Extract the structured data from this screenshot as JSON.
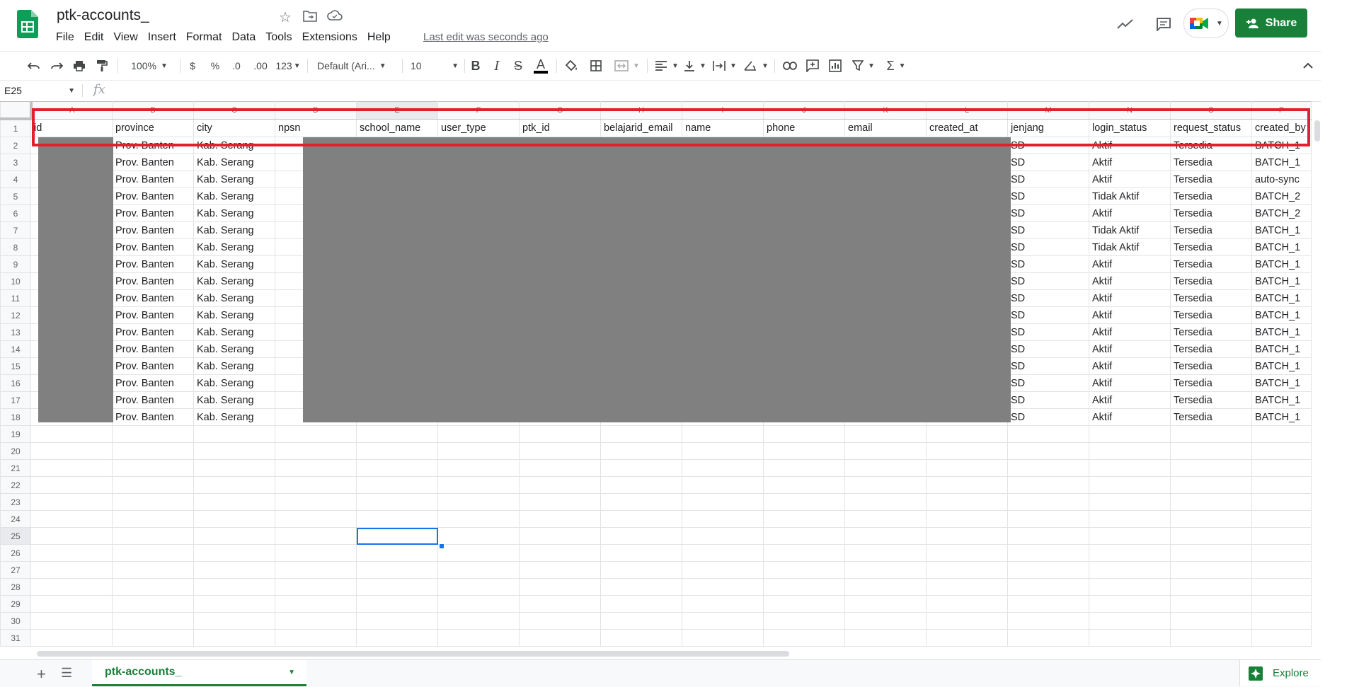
{
  "doc": {
    "title": "ptk-accounts_",
    "last_edit": "Last edit was seconds ago"
  },
  "menu": [
    "File",
    "Edit",
    "View",
    "Insert",
    "Format",
    "Data",
    "Tools",
    "Extensions",
    "Help"
  ],
  "header": {
    "share_label": "Share"
  },
  "toolbar": {
    "zoom": "100%",
    "currency": "$",
    "percent": "%",
    "dec_decrease": ".0",
    "dec_increase": ".00",
    "more_formats": "123",
    "font": "Default (Ari...",
    "font_size": "10",
    "bold": "B",
    "italic": "I",
    "strike": "S",
    "text_color": "A"
  },
  "formula_bar": {
    "name_box": "E25",
    "fx": "fx"
  },
  "columns": [
    "A",
    "B",
    "C",
    "D",
    "E",
    "F",
    "G",
    "H",
    "I",
    "J",
    "K",
    "L",
    "M",
    "N",
    "O",
    "P"
  ],
  "header_row": [
    "id",
    "province",
    "city",
    "npsn",
    "school_name",
    "user_type",
    "ptk_id",
    "belajarid_email",
    "name",
    "phone",
    "email",
    "created_at",
    "jenjang",
    "login_status",
    "request_status",
    "created_by"
  ],
  "rows": [
    [
      "",
      "Prov. Banten",
      "Kab. Serang",
      "",
      "",
      "",
      "",
      "",
      "",
      "",
      "",
      "",
      "SD",
      "Aktif",
      "Tersedia",
      "BATCH_1"
    ],
    [
      "",
      "Prov. Banten",
      "Kab. Serang",
      "",
      "",
      "",
      "",
      "",
      "",
      "",
      "",
      "",
      "SD",
      "Aktif",
      "Tersedia",
      "BATCH_1"
    ],
    [
      "",
      "Prov. Banten",
      "Kab. Serang",
      "",
      "",
      "",
      "",
      "",
      "",
      "",
      "",
      "",
      "SD",
      "Aktif",
      "Tersedia",
      "auto-sync"
    ],
    [
      "",
      "Prov. Banten",
      "Kab. Serang",
      "",
      "",
      "",
      "",
      "",
      "",
      "",
      "",
      "",
      "SD",
      "Tidak Aktif",
      "Tersedia",
      "BATCH_2"
    ],
    [
      "",
      "Prov. Banten",
      "Kab. Serang",
      "",
      "",
      "",
      "",
      "",
      "",
      "",
      "",
      "",
      "SD",
      "Aktif",
      "Tersedia",
      "BATCH_2"
    ],
    [
      "",
      "Prov. Banten",
      "Kab. Serang",
      "",
      "",
      "",
      "",
      "",
      "",
      "",
      "",
      "",
      "SD",
      "Tidak Aktif",
      "Tersedia",
      "BATCH_1"
    ],
    [
      "",
      "Prov. Banten",
      "Kab. Serang",
      "",
      "",
      "",
      "",
      "",
      "",
      "",
      "",
      "",
      "SD",
      "Tidak Aktif",
      "Tersedia",
      "BATCH_1"
    ],
    [
      "",
      "Prov. Banten",
      "Kab. Serang",
      "",
      "",
      "",
      "",
      "",
      "",
      "",
      "",
      "",
      "SD",
      "Aktif",
      "Tersedia",
      "BATCH_1"
    ],
    [
      "",
      "Prov. Banten",
      "Kab. Serang",
      "",
      "",
      "",
      "",
      "",
      "",
      "",
      "",
      "",
      "SD",
      "Aktif",
      "Tersedia",
      "BATCH_1"
    ],
    [
      "",
      "Prov. Banten",
      "Kab. Serang",
      "",
      "",
      "",
      "",
      "",
      "",
      "",
      "",
      "",
      "SD",
      "Aktif",
      "Tersedia",
      "BATCH_1"
    ],
    [
      "",
      "Prov. Banten",
      "Kab. Serang",
      "",
      "",
      "",
      "",
      "",
      "",
      "",
      "",
      "",
      "SD",
      "Aktif",
      "Tersedia",
      "BATCH_1"
    ],
    [
      "",
      "Prov. Banten",
      "Kab. Serang",
      "",
      "",
      "",
      "",
      "",
      "",
      "",
      "",
      "",
      "SD",
      "Aktif",
      "Tersedia",
      "BATCH_1"
    ],
    [
      "",
      "Prov. Banten",
      "Kab. Serang",
      "",
      "",
      "",
      "",
      "",
      "",
      "",
      "",
      "",
      "SD",
      "Aktif",
      "Tersedia",
      "BATCH_1"
    ],
    [
      "",
      "Prov. Banten",
      "Kab. Serang",
      "",
      "",
      "",
      "",
      "",
      "",
      "",
      "",
      "",
      "SD",
      "Aktif",
      "Tersedia",
      "BATCH_1"
    ],
    [
      "",
      "Prov. Banten",
      "Kab. Serang",
      "",
      "",
      "",
      "",
      "",
      "",
      "",
      "",
      "",
      "SD",
      "Aktif",
      "Tersedia",
      "BATCH_1"
    ],
    [
      "",
      "Prov. Banten",
      "Kab. Serang",
      "",
      "",
      "",
      "",
      "",
      "",
      "",
      "",
      "",
      "SD",
      "Aktif",
      "Tersedia",
      "BATCH_1"
    ],
    [
      "",
      "Prov. Banten",
      "Kab. Serang",
      "",
      "",
      "",
      "",
      "",
      "",
      "",
      "",
      "",
      "SD",
      "Aktif",
      "Tersedia",
      "BATCH_1"
    ]
  ],
  "total_rows": 31,
  "active_cell": {
    "row": 25,
    "col": "E"
  },
  "sheet_tab": {
    "label": "ptk-accounts_"
  },
  "explore_label": "Explore",
  "colors": {
    "brand_green": "#188038",
    "active_blue": "#1a73e8",
    "highlight_red": "#e0202e",
    "redaction": "#808080"
  },
  "icons": [
    "sheets-logo",
    "star-icon",
    "move-icon",
    "cloud-icon",
    "trend-icon",
    "comment-icon",
    "meet-icon",
    "person-add-icon",
    "undo-icon",
    "redo-icon",
    "print-icon",
    "paint-format-icon",
    "fill-color-icon",
    "borders-icon",
    "merge-icon",
    "align-icon",
    "valign-icon",
    "wrap-icon",
    "rotate-icon",
    "link-icon",
    "comment-add-icon",
    "chart-icon",
    "filter-icon",
    "functions-icon",
    "collapse-icon",
    "add-sheet-icon",
    "all-sheets-icon",
    "explore-icon"
  ]
}
